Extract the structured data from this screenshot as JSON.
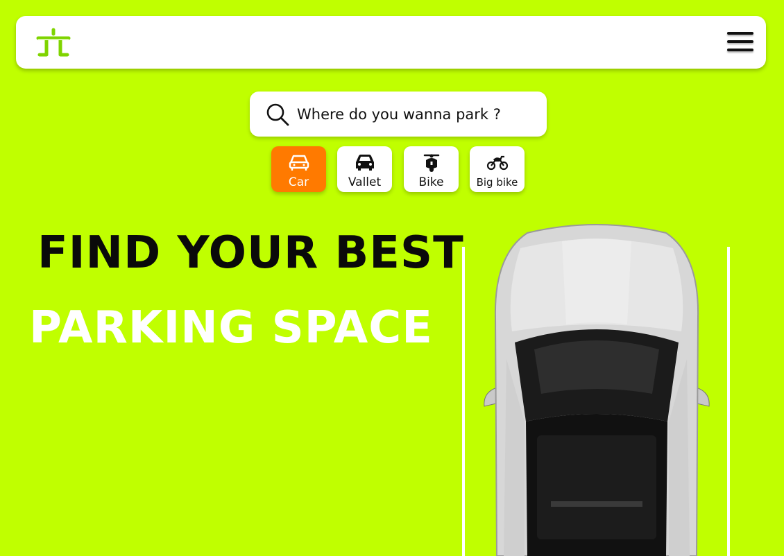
{
  "navbar": {
    "logo_icon": "parking-logo-icon",
    "menu_icon": "hamburger-menu-icon"
  },
  "search": {
    "icon": "search-icon",
    "placeholder": "Where do you wanna park ?"
  },
  "vehicle_types": [
    {
      "label": "Car",
      "icon": "car-icon",
      "active": true
    },
    {
      "label": "Vallet",
      "icon": "valet-car-icon",
      "active": false
    },
    {
      "label": "Bike",
      "icon": "scooter-icon",
      "active": false
    },
    {
      "label": "Big bike",
      "icon": "motorcycle-icon",
      "active": false
    }
  ],
  "hero": {
    "line1": "FIND YOUR BEST",
    "line2": "PARKING SPACE"
  },
  "colors": {
    "background": "#c0ff00",
    "active_chip": "#ff7a00",
    "surface": "#ffffff"
  }
}
